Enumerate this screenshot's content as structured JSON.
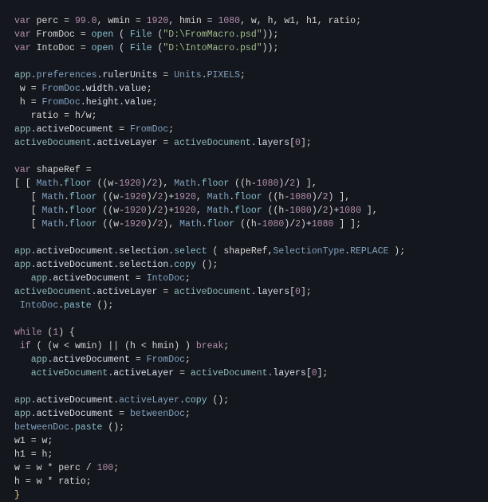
{
  "code": {
    "lines": [
      "var perc = 99.0, wmin = 1920, hmin = 1080, w, h, w1, h1, ratio;",
      "var FromDoc = open ( File (\"D:\\FromMacro.psd\"));",
      "var IntoDoc = open ( File (\"D:\\IntoMacro.psd\"));",
      "",
      "app.preferences.rulerUnits = Units.PIXELS;",
      " w = FromDoc.width.value;",
      " h = FromDoc.height.value;",
      "   ratio = h/w;",
      "app.activeDocument = FromDoc;",
      "activeDocument.activeLayer = activeDocument.layers[0];",
      "",
      "var shapeRef =",
      "[ [ Math.floor ((w-1920)/2), Math.floor ((h-1080)/2) ],",
      "   [ Math.floor ((w-1920)/2)+1920, Math.floor ((h-1080)/2) ],",
      "   [ Math.floor ((w-1920)/2)+1920, Math.floor ((h-1080)/2)+1080 ],",
      "   [ Math.floor ((w-1920)/2), Math.floor ((h-1080)/2)+1080 ] ];",
      "",
      "app.activeDocument.selection.select ( shapeRef,SelectionType.REPLACE );",
      "app.activeDocument.selection.copy ();",
      "   app.activeDocument = IntoDoc;",
      "activeDocument.activeLayer = activeDocument.layers[0];",
      " IntoDoc.paste ();",
      "",
      "while (1) {",
      " if ( (w < wmin) || (h < hmin) ) break;",
      "   app.activeDocument = FromDoc;",
      "   activeDocument.activeLayer = activeDocument.layers[0];",
      "",
      "app.activeDocument.activeLayer.copy ();",
      "app.activeDocument = betweenDoc;",
      "betweenDoc.paste ();",
      "w1 = w;",
      "h1 = h;",
      "w = w * perc / 100;",
      "h = w * ratio;",
      "}"
    ]
  }
}
